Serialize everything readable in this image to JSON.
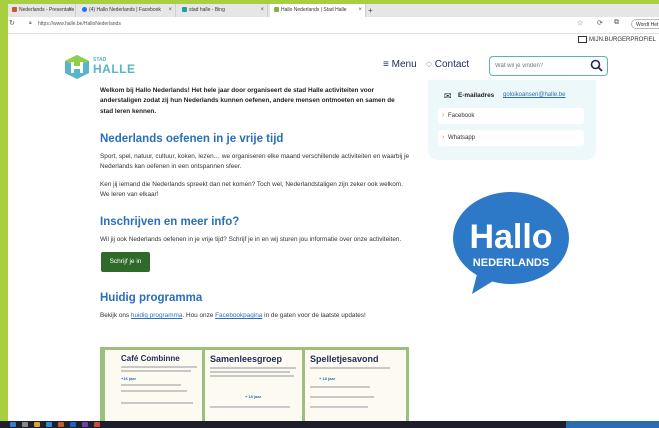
{
  "browser": {
    "tabs": [
      {
        "label": "Nederlands - Presentatie",
        "favicon_color": "#c75b2b"
      },
      {
        "label": "(4) Hallo Nederlands | Facebook",
        "favicon_color": "#1877f2"
      },
      {
        "label": "stad halle - Bing",
        "favicon_color": "#1aa39a"
      },
      {
        "label": "Hallo Nederlands | Stad Halle",
        "favicon_color": "#7cb342",
        "active": true
      }
    ],
    "new_tab": "+",
    "url": "https://www.halle.be/HalloNederlands",
    "word_button": "Wordt Het g"
  },
  "header": {
    "account": "MIJN.BURGERPROFIEL",
    "logo_small": "STAD",
    "logo_big": "HALLE",
    "menu_label": "Menu",
    "contact_label": "Contact",
    "search_placeholder": "Wat wil je vinden?"
  },
  "content": {
    "intro": "Welkom bij Hallo Nederlands! Het hele jaar door organiseert de stad Halle activiteiten voor anderstaligen zodat zij hun Nederlands kunnen oefenen, andere mensen ontmoeten en samen de stad leren kennen.",
    "h_practice": "Nederlands oefenen in je vrije tijd",
    "p_practice1": "Sport, spel, natuur, cultuur, koken, lezen… we organiseren elke maand verschillende activiteiten en waarbij je Nederlands kan oefenen in een ontspannen sfeer.",
    "p_practice2": "Ken jij iemand die Nederlands spreekt dan net komen? Toch wel, Nederlandstaligen zijn zeker ook welkom. We leren van elkaar!",
    "h_register": "Inschrijven en meer info?",
    "p_register": "Wil jij ook Nederlands oefenen in je vrije tijd? Schrijf je in en wij sturen jou informatie over onze activiteiten.",
    "join_button": "Schrijf je in",
    "h_program": "Huidig programma",
    "p_program_pre": "Bekijk ons ",
    "p_program_link1": "huidig programma",
    "p_program_mid": ". Hou onze ",
    "p_program_link2": "Facebookpagina",
    "p_program_post": " in de gaten voor de laatste updates!"
  },
  "sidebar": {
    "email_label": "E-mailadres",
    "email_value": "goloikoansen@halle.be",
    "links": [
      "Facebook",
      "Whatsapp"
    ],
    "hallo_logo_top": "Hallo",
    "hallo_logo_bottom": "NEDERLANDS"
  },
  "program_image": {
    "cards": [
      {
        "title": "Café Combinne",
        "sub": "+16 jaar"
      },
      {
        "title": "Samenleesgroep",
        "sub": "+ 18 jaar"
      },
      {
        "title": "Spelletjesavond",
        "sub": "+ 18 jaar"
      }
    ]
  },
  "colors": {
    "brand_green": "#a7cf3f",
    "heading_blue": "#2a6fb7",
    "button_green": "#2f6a2a",
    "logo_blue": "#2d79c7"
  }
}
